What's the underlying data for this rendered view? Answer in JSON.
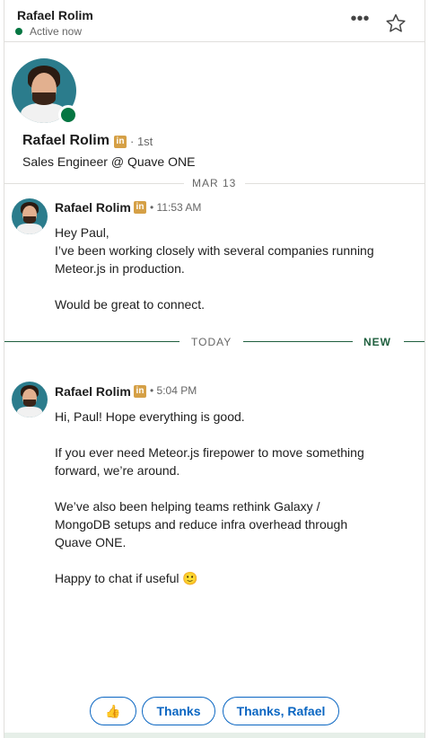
{
  "header": {
    "name": "Rafael Rolim",
    "status": "Active now",
    "more_label": "•••"
  },
  "profile": {
    "name": "Rafael Rolim",
    "badge": "in",
    "degree": "· 1st",
    "headline": "Sales Engineer @ Quave ONE"
  },
  "dividers": {
    "first_date": "MAR 13",
    "today": "TODAY",
    "new": "NEW"
  },
  "messages": [
    {
      "sender": "Rafael Rolim",
      "badge": "in",
      "time": "• 11:53 AM",
      "body": "Hey Paul,\nI’ve been working closely with several companies running Meteor.js in production.\n\nWould be great to connect."
    },
    {
      "sender": "Rafael Rolim",
      "badge": "in",
      "time": "• 5:04 PM",
      "body": "Hi, Paul! Hope everything is good.\n\nIf you ever need Meteor.js firepower to move something forward, we’re around.\n\nWe’ve also been helping teams rethink Galaxy / MongoDB setups and reduce infra overhead through Quave ONE.\n\nHappy to chat if useful 🙂"
    }
  ],
  "quick_replies": [
    {
      "label": "👍"
    },
    {
      "label": "Thanks"
    },
    {
      "label": "Thanks, Rafael"
    }
  ],
  "colors": {
    "online": "#057642",
    "linkedin_badge": "#d5a046",
    "chip_blue": "#0a66c2",
    "new_divider": "#1f5f3e"
  }
}
